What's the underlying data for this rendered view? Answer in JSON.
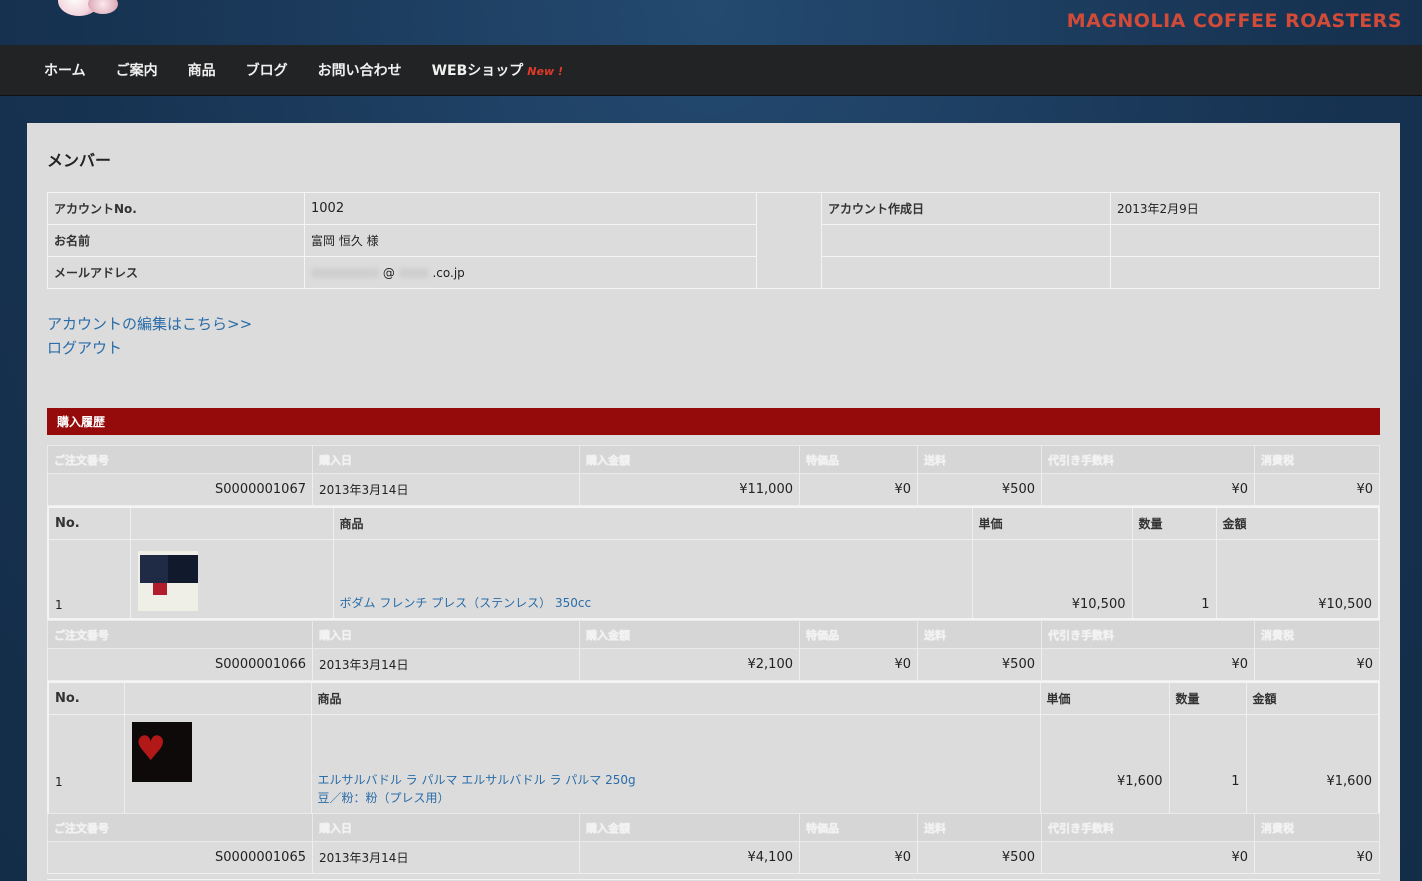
{
  "header": {
    "brand": "MAGNOLIA COFFEE ROASTERS"
  },
  "nav": {
    "items": [
      "ホーム",
      "ご案内",
      "商品",
      "ブログ",
      "お問い合わせ",
      "WEBショップ"
    ],
    "new_badge": "New !"
  },
  "page": {
    "title": "メンバー"
  },
  "account": {
    "number_label": "アカウントNo.",
    "number_value": "1002",
    "name_label": "お名前",
    "name_value": "富岡 恒久 様",
    "email_label": "メールアドレス",
    "email_at": "@",
    "email_suffix": ".co.jp",
    "created_label": "アカウント作成日",
    "created_value": "2013年2月9日"
  },
  "links": {
    "edit_account": "アカウントの編集はこちら>>",
    "logout": "ログアウト"
  },
  "history": {
    "title": "購入履歴",
    "order_headers": [
      "ご注文番号",
      "購入日",
      "購入金額",
      "特価品",
      "送料",
      "代引き手数料",
      "消費税"
    ],
    "item_headers": [
      "No.",
      "商品",
      "単価",
      "数量",
      "金額"
    ],
    "orders": [
      {
        "number": "S0000001067",
        "date": "2013年3月14日",
        "amount": "¥11,000",
        "special": "¥0",
        "shipping": "¥500",
        "cod_fee": "¥0",
        "tax": "¥0",
        "items": [
          {
            "no": "1",
            "name": "ボダム フレンチ プレス（ステンレス） 350cc",
            "option": "",
            "unit_price": "¥10,500",
            "qty": "1",
            "total": "¥10,500"
          }
        ]
      },
      {
        "number": "S0000001066",
        "date": "2013年3月14日",
        "amount": "¥2,100",
        "special": "¥0",
        "shipping": "¥500",
        "cod_fee": "¥0",
        "tax": "¥0",
        "items": [
          {
            "no": "1",
            "name": "エルサルバドル ラ パルマ エルサルバドル ラ パルマ 250g",
            "option": "豆／粉：粉（プレス用）",
            "unit_price": "¥1,600",
            "qty": "1",
            "total": "¥1,600"
          }
        ]
      },
      {
        "number": "S0000001065",
        "date": "2013年3月14日",
        "amount": "¥4,100",
        "special": "¥0",
        "shipping": "¥500",
        "cod_fee": "¥0",
        "tax": "¥0",
        "items": []
      }
    ]
  },
  "colors": {
    "brand": "#d24a38",
    "history_bar": "#950a0a",
    "link": "#2a6ca8",
    "nav_bg": "#222325"
  }
}
